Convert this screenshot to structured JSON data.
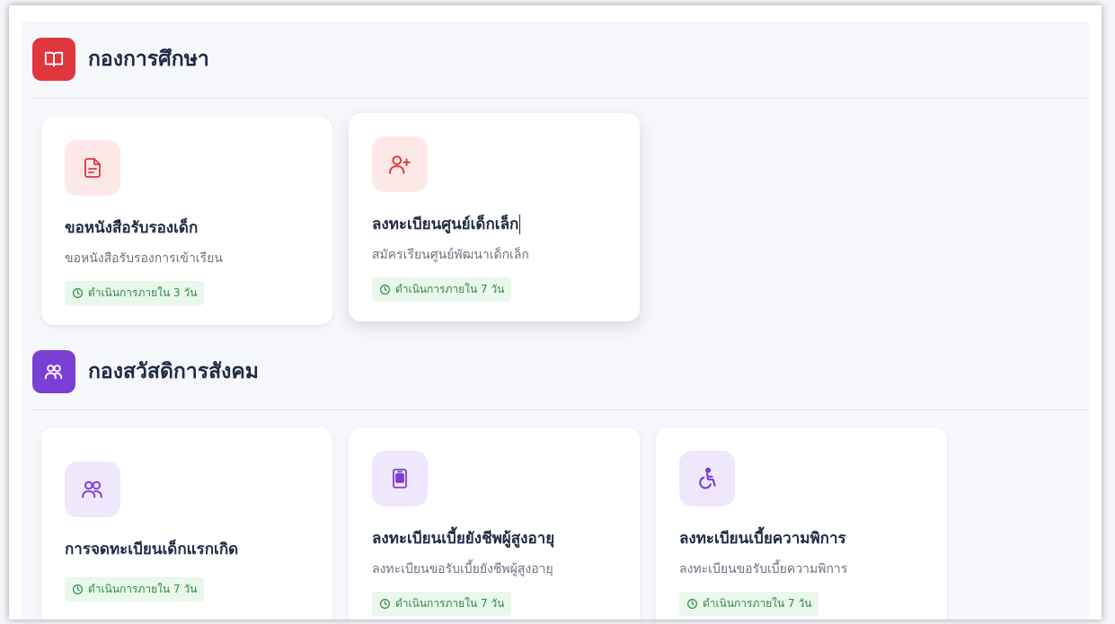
{
  "colors": {
    "education_accent": "#e0363d",
    "education_soft": "#fde8e8",
    "welfare_accent": "#7b3fd6",
    "welfare_soft": "#efe7fb",
    "badge_bg": "#e9f7ec",
    "badge_text": "#2f8a46"
  },
  "sections": [
    {
      "title": "กองการศึกษา",
      "icon": "book-open-icon",
      "cards": [
        {
          "icon": "document-icon",
          "title": "ขอหนังสือรับรองเด็ก",
          "description": "ขอหนังสือรับรองการเข้าเรียน",
          "badge": "ดำเนินการภายใน 3 วัน"
        },
        {
          "icon": "user-plus-icon",
          "title": "ลงทะเบียนศูนย์เด็กเล็ก",
          "description": "สมัครเรียนศูนย์พัฒนาเด็กเล็ก",
          "badge": "ดำเนินการภายใน 7 วัน"
        }
      ]
    },
    {
      "title": "กองสวัสดิการสังคม",
      "icon": "users-icon",
      "cards": [
        {
          "icon": "users-icon",
          "title": "การจดทะเบียนเด็กแรกเกิด",
          "description": "",
          "badge": "ดำเนินการภายใน 7 วัน"
        },
        {
          "icon": "id-card-icon",
          "title": "ลงทะเบียนเบี้ยยังชีพผู้สูงอายุ",
          "description": "ลงทะเบียนขอรับเบี้ยยังชีพผู้สูงอายุ",
          "badge": "ดำเนินการภายใน 7 วัน"
        },
        {
          "icon": "wheelchair-icon",
          "title": "ลงทะเบียนเบี้ยความพิการ",
          "description": "ลงทะเบียนขอรับเบี้ยความพิการ",
          "badge": "ดำเนินการภายใน 7 วัน"
        }
      ]
    }
  ]
}
